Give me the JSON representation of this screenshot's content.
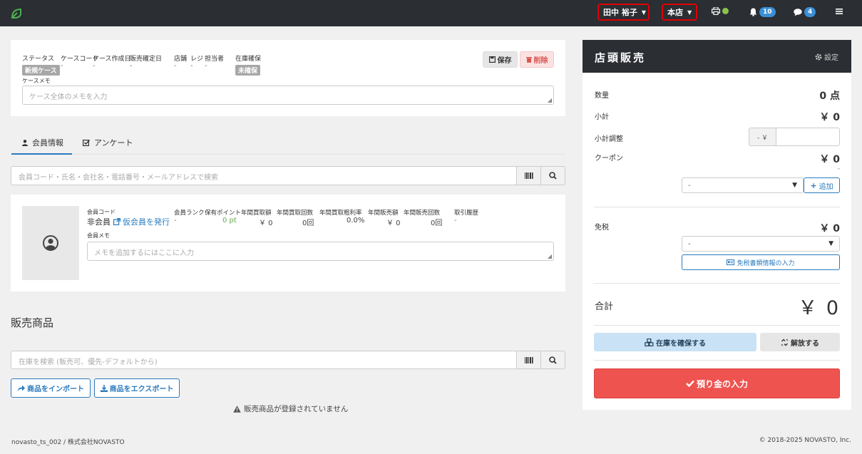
{
  "topbar": {
    "user_name": "田中 裕子",
    "store": "本店",
    "notifications_count": "10",
    "messages_count": "4"
  },
  "case": {
    "headers": [
      "ステータス",
      "ケースコード",
      "ケース作成日",
      "販売確定日",
      "店舗",
      "レジ",
      "担当者",
      "在庫確保"
    ],
    "status_badge": "新規ケース",
    "values": [
      "-",
      "-",
      "-",
      "-",
      "-",
      "-"
    ],
    "stock_badge": "未確保",
    "memo_label": "ケースメモ",
    "memo_placeholder": "ケース全体のメモを入力",
    "save_label": "保存",
    "delete_label": "削除"
  },
  "tabs": [
    {
      "label": "会員情報"
    },
    {
      "label": "アンケート"
    }
  ],
  "member_search_placeholder": "会員コード・氏名・会社名・電話番号・メールアドレスで検索",
  "member": {
    "code_label": "会員コード",
    "code_value": "非会員",
    "issue_link": "仮会員を発行",
    "stat_headers": [
      "会員ランク",
      "保有ポイント",
      "年間買取額",
      "年間買取回数",
      "年間買取粗利率",
      "年間販売額",
      "年間販売回数",
      "取引履歴"
    ],
    "stat_values": [
      "-",
      "0 pt",
      "￥ 0",
      "0回",
      "0.0%",
      "￥ 0",
      "0回",
      "-"
    ],
    "memo_label": "会員メモ",
    "memo_placeholder": "メモを追加するにはここに入力"
  },
  "products": {
    "title": "販売商品",
    "search_placeholder": "在庫を検索 (販売可、優先-デフォルトから)",
    "import_label": "商品をインポート",
    "export_label": "商品をエクスポート",
    "empty_message": "販売商品が登録されていません"
  },
  "register": {
    "title": "店頭販売",
    "settings_label": "設定",
    "quantity_label": "数量",
    "quantity_value": "0 点",
    "subtotal_label": "小計",
    "subtotal_value": "￥ 0",
    "adjust_label": "小計調整",
    "adjust_prefix": "- ￥",
    "coupon_label": "クーポン",
    "coupon_value": "￥ 0",
    "coupon_sub": "-",
    "coupon_select": "-",
    "add_label": "追加",
    "tax_free_label": "免税",
    "tax_free_value": "￥ 0",
    "tax_free_select": "-",
    "tax_doc_label": "免税書類情報の入力",
    "total_label": "合計",
    "total_value": "￥ 0",
    "reserve_label": "在庫を確保する",
    "release_label": "解放する",
    "deposit_label": "預り金の入力"
  },
  "footer": {
    "left": "novasto_ts_002 / 株式会社NOVASTO",
    "right": "© 2018-2025 NOVASTO, Inc."
  },
  "colors": {
    "topbar": "#2b2e33",
    "accent": "#2a7bbf",
    "danger": "#ef5350",
    "reserve_bg": "#c9e2f5",
    "points_green": "#6aa84f"
  }
}
